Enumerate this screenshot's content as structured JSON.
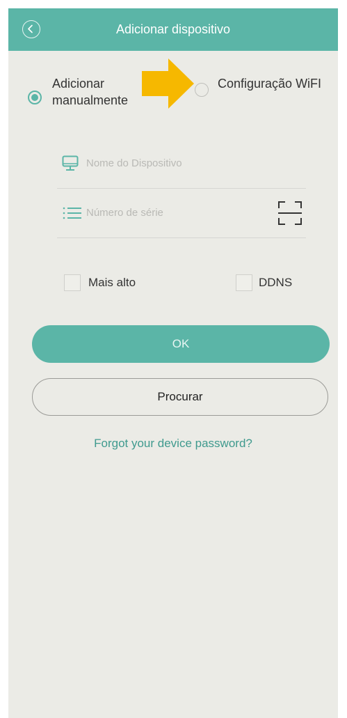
{
  "header": {
    "title": "Adicionar dispositivo",
    "back_icon": "chevron-left-icon"
  },
  "mode": {
    "manual_label": "Adicionar manualmente",
    "manual_selected": true,
    "wifi_label": "Configuração WiFI",
    "wifi_selected": false
  },
  "form": {
    "device_name": {
      "placeholder": "Nome do Dispositivo",
      "value": "",
      "icon": "monitor-icon"
    },
    "serial": {
      "placeholder": "Número de série",
      "value": "",
      "icon": "list-icon",
      "scan_icon": "qr-scan-icon"
    }
  },
  "options": {
    "mais_alto_label": "Mais alto",
    "mais_alto_checked": false,
    "ddns_label": "DDNS",
    "ddns_checked": false
  },
  "buttons": {
    "ok_label": "OK",
    "search_label": "Procurar"
  },
  "links": {
    "forgot_password": "Forgot your device password?"
  },
  "colors": {
    "accent": "#5bb5a7",
    "background": "#ebebe6",
    "link": "#3f9a8e",
    "annotation_arrow": "#f6b800"
  }
}
